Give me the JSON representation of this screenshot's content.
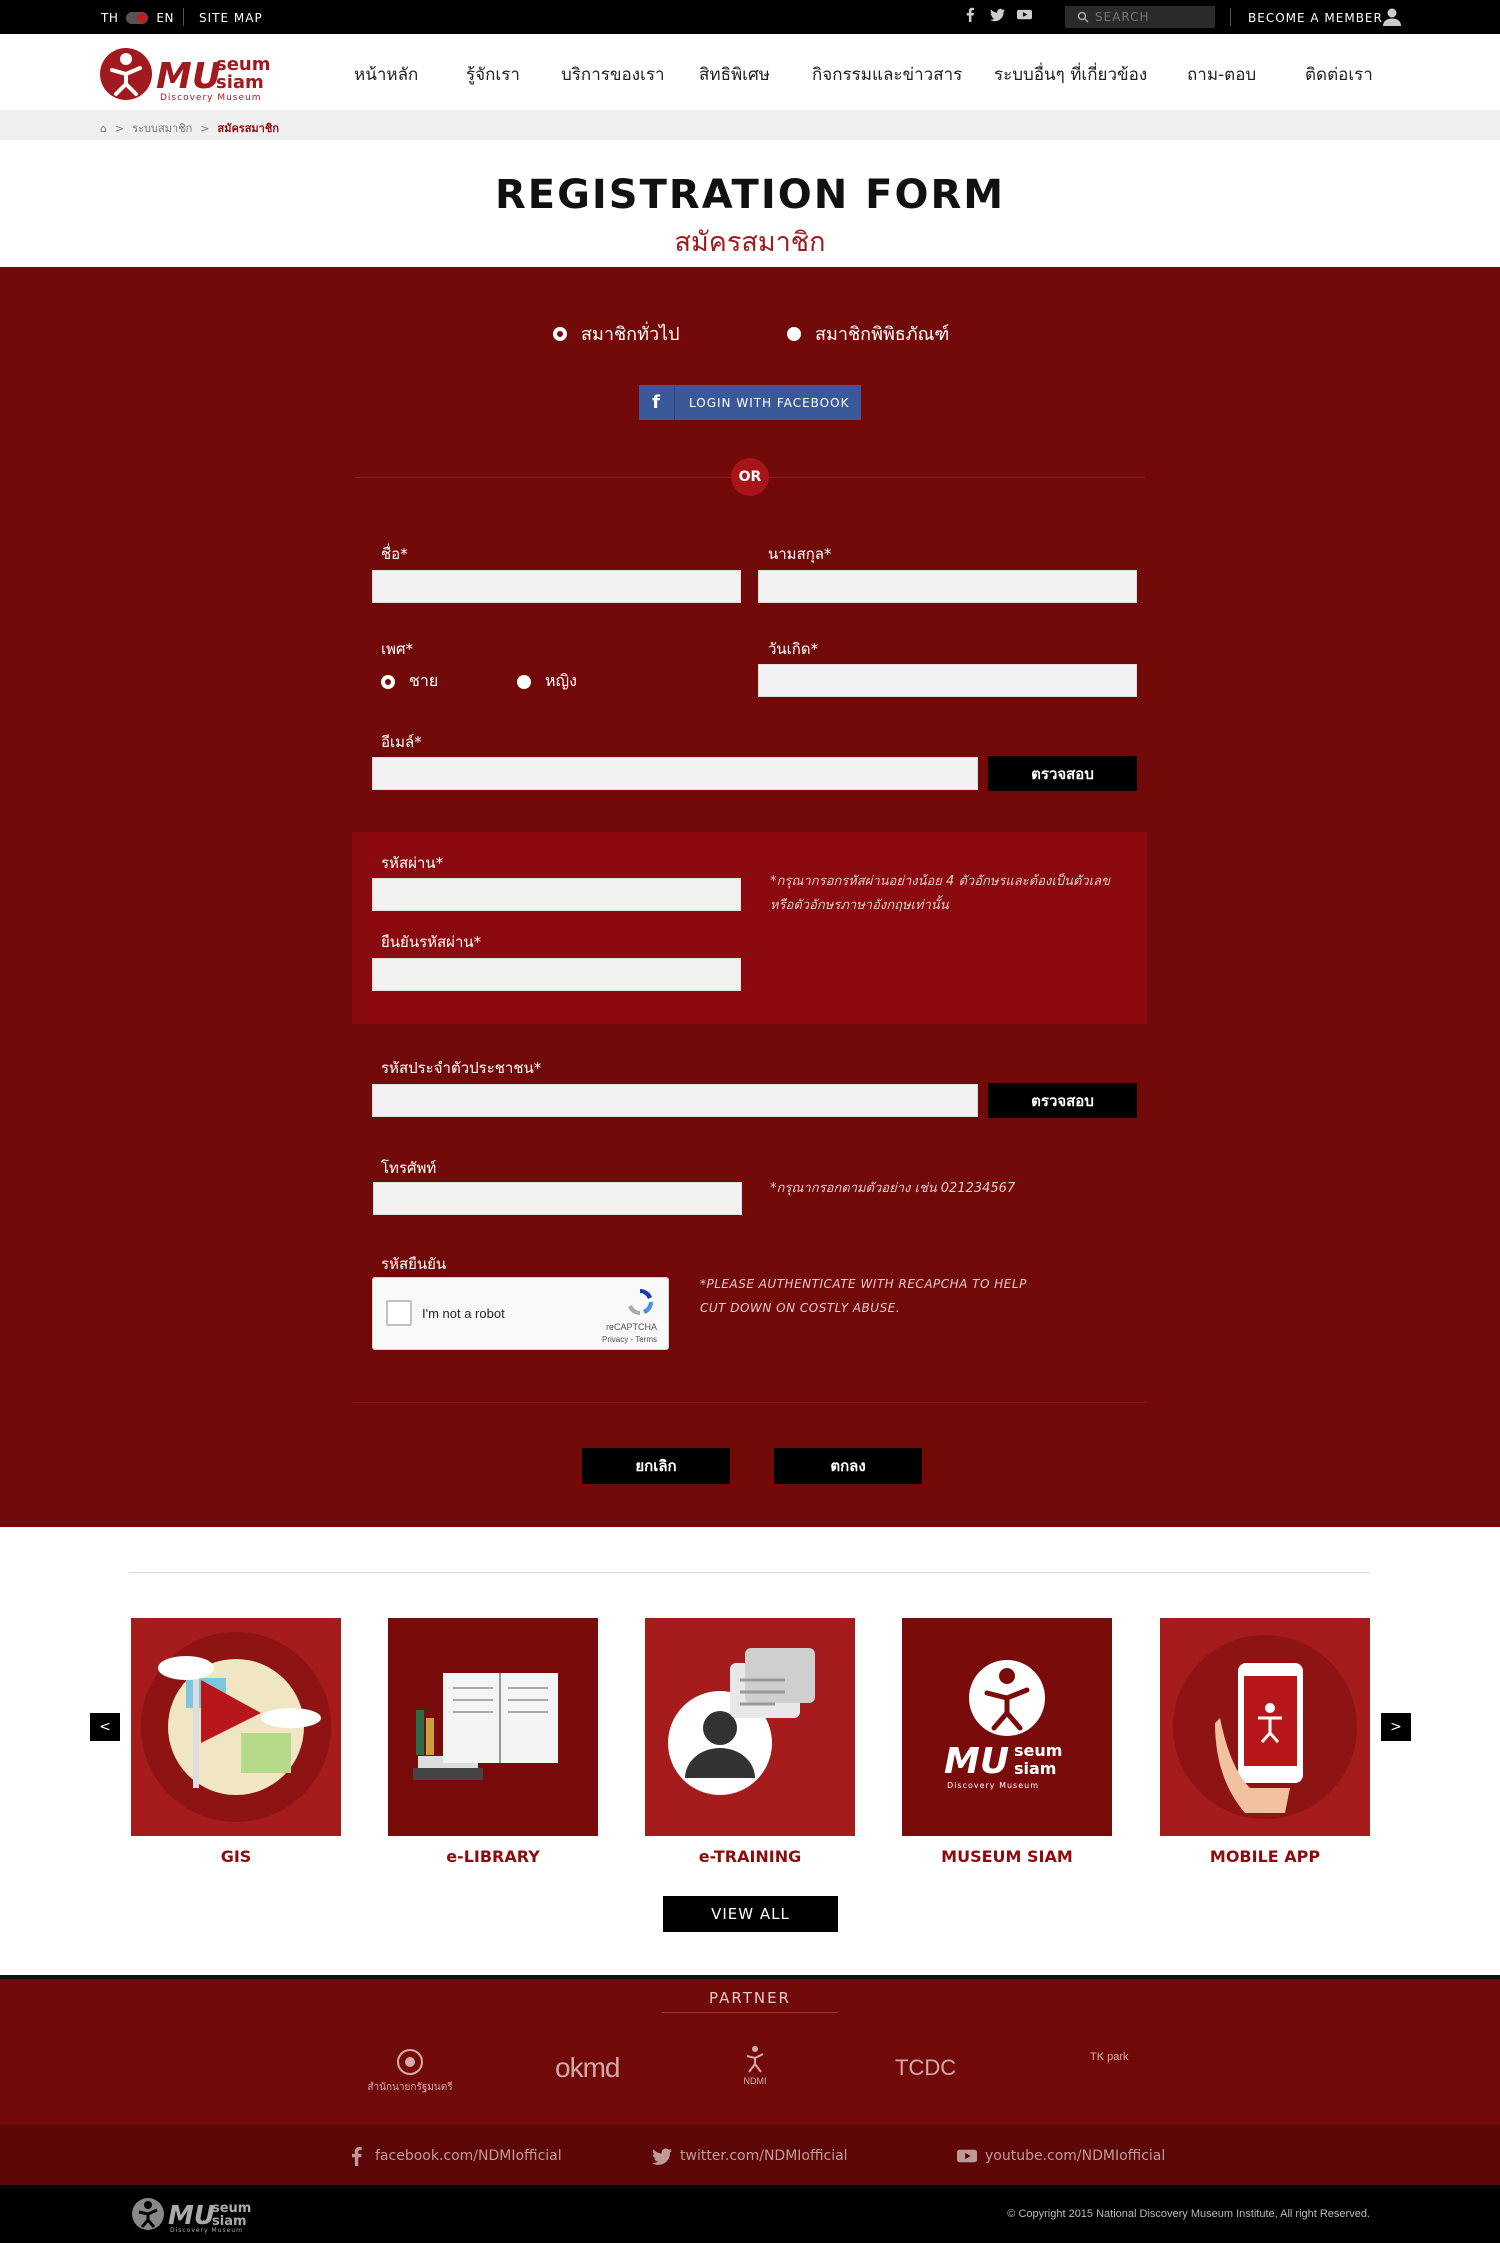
{
  "topbar": {
    "lang_th": "TH",
    "lang_en": "EN",
    "sitemap": "SITE MAP",
    "search_placeholder": "SEARCH",
    "member": "BECOME A MEMBER"
  },
  "logo": {
    "mu": "MU",
    "seum": "seum",
    "siam": "siam",
    "tagline": "Discovery Museum"
  },
  "nav": {
    "items": [
      "หน้าหลัก",
      "รู้จักเรา",
      "บริการของเรา",
      "สิทธิพิเศษ",
      "กิจกรรมและข่าวสาร",
      "ระบบอื่นๆ ที่เกี่ยวข้อง",
      "ถาม-ตอบ",
      "ติดต่อเรา"
    ]
  },
  "breadcrumb": {
    "home": "⌂",
    "sep": ">",
    "level1": "ระบบสมาชิก",
    "current": "สมัครสมาชิก"
  },
  "title": {
    "en": "REGISTRATION FORM",
    "th": "สมัครสมาชิก"
  },
  "member_type": {
    "general": "สมาชิกทั่วไป",
    "museum": "สมาชิกพิพิธภัณฑ์",
    "selected": "general"
  },
  "facebook": {
    "icon": "f",
    "label": "LOGIN WITH FACEBOOK"
  },
  "or": "OR",
  "fields": {
    "firstname_label": "ชื่อ*",
    "lastname_label": "นามสกุล*",
    "gender_label": "เพศ*",
    "gender_male": "ชาย",
    "gender_female": "หญิง",
    "gender_selected": "male",
    "birthday_label": "วันเกิด*",
    "email_label": "อีเมล์*",
    "check_button": "ตรวจสอบ",
    "password_label": "รหัสผ่าน*",
    "confirm_password_label": "ยืนยันรหัสผ่าน*",
    "password_hint_1": "*กรุณากรอกรหัสผ่านอย่างน้อย 4 ตัวอักษรและต้องเป็นตัวเลข",
    "password_hint_2": "หรือตัวอักษรภาษาอังกฤษเท่านั้น",
    "id_card_label": "รหัสประจำตัวประชาชน*",
    "phone_label": "โทรศัพท์",
    "phone_hint": "*กรุณากรอกตามตัวอย่าง เช่น 021234567",
    "captcha_label": "รหัสยืนยัน",
    "captcha_text": "I'm not a robot",
    "captcha_brand": "reCAPTCHA",
    "captcha_terms": "Privacy - Terms",
    "captcha_hint_1": "*PLEASE AUTHENTICATE WITH RECAPCHA TO HELP",
    "captcha_hint_2": "CUT DOWN ON COSTLY ABUSE."
  },
  "actions": {
    "cancel": "ยกเลิก",
    "submit": "ตกลง"
  },
  "services": {
    "items": [
      {
        "label": "GIS",
        "icon": "map-flag-icon"
      },
      {
        "label": "e-LIBRARY",
        "icon": "book-icon"
      },
      {
        "label": "e-TRAINING",
        "icon": "chat-person-icon"
      },
      {
        "label": "MUSEUM SIAM",
        "icon": "museum-siam-logo"
      },
      {
        "label": "MOBILE APP",
        "icon": "phone-hand-icon"
      }
    ],
    "prev": "<",
    "next": ">",
    "view_all": "VIEW ALL"
  },
  "partner": {
    "title": "PARTNER",
    "logos": [
      "สำนักนายกรัฐมนตรี",
      "okmd",
      "NDMI",
      "TCDC",
      "TK park"
    ]
  },
  "social_footer": {
    "facebook": "facebook.com/NDMIofficial",
    "twitter": "twitter.com/NDMIofficial",
    "youtube": "youtube.com/NDMIofficial"
  },
  "copyright": "© Copyright 2015 National Discovery Museum Institute, All right Reserved.",
  "colors": {
    "brand": "#730a0a",
    "accent": "#a11a1f",
    "facebook": "#3b5998"
  }
}
